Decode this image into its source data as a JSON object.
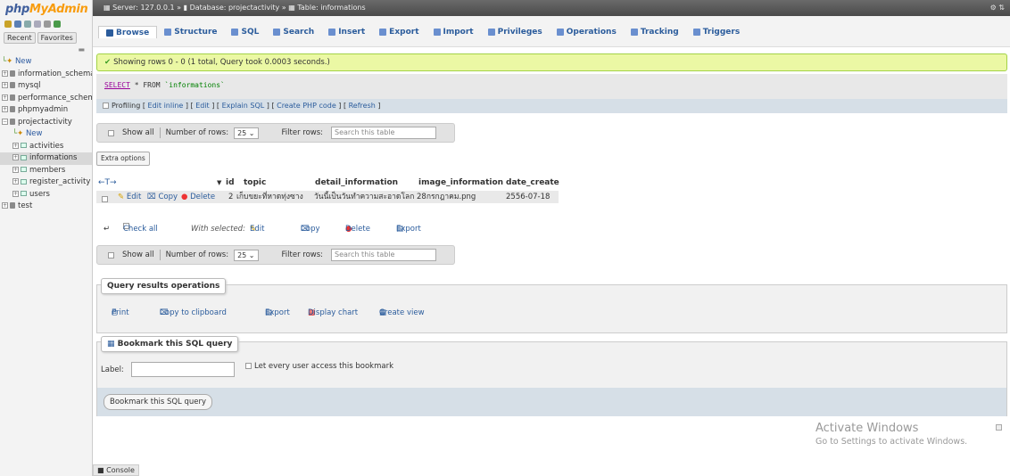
{
  "nav": {
    "logo": {
      "php": "php",
      "my": "My",
      "admin": "Admin"
    },
    "tabs": [
      "Recent",
      "Favorites"
    ],
    "items": [
      {
        "label": "New",
        "kind": "new",
        "level": 0
      },
      {
        "label": "information_schema",
        "kind": "db",
        "level": 0
      },
      {
        "label": "mysql",
        "kind": "db",
        "level": 0
      },
      {
        "label": "performance_schema",
        "kind": "db",
        "level": 0
      },
      {
        "label": "phpmyadmin",
        "kind": "db",
        "level": 0
      },
      {
        "label": "projectactivity",
        "kind": "db",
        "level": 0
      },
      {
        "label": "New",
        "kind": "new",
        "level": 1
      },
      {
        "label": "activities",
        "kind": "table",
        "level": 1
      },
      {
        "label": "informations",
        "kind": "table",
        "level": 1,
        "selected": true
      },
      {
        "label": "members",
        "kind": "table",
        "level": 1
      },
      {
        "label": "register_activity",
        "kind": "table",
        "level": 1
      },
      {
        "label": "users",
        "kind": "table",
        "level": 1
      },
      {
        "label": "test",
        "kind": "db",
        "level": 0
      }
    ]
  },
  "breadcrumb": {
    "server": "Server: 127.0.0.1",
    "database": "Database: projectactivity",
    "table": "Table: informations",
    "sep": "»"
  },
  "tabs": [
    {
      "label": "Browse",
      "icon": "browse-icon",
      "color": "#2b5c9c",
      "active": true
    },
    {
      "label": "Structure",
      "icon": "structure-icon",
      "color": "#6a8fcf"
    },
    {
      "label": "SQL",
      "icon": "sql-icon",
      "color": "#6a8fcf"
    },
    {
      "label": "Search",
      "icon": "search-icon",
      "color": "#6a8fcf"
    },
    {
      "label": "Insert",
      "icon": "insert-icon",
      "color": "#6a8fcf"
    },
    {
      "label": "Export",
      "icon": "export-icon",
      "color": "#6a8fcf"
    },
    {
      "label": "Import",
      "icon": "import-icon",
      "color": "#6a8fcf"
    },
    {
      "label": "Privileges",
      "icon": "privileges-icon",
      "color": "#6a8fcf"
    },
    {
      "label": "Operations",
      "icon": "wrench-icon",
      "color": "#6a8fcf"
    },
    {
      "label": "Tracking",
      "icon": "tracking-icon",
      "color": "#6a8fcf"
    },
    {
      "label": "Triggers",
      "icon": "triggers-icon",
      "color": "#6a8fcf"
    }
  ],
  "message": {
    "text": "Showing rows 0 - 0 (1 total, Query took 0.0003 seconds.)"
  },
  "sql": {
    "select": "SELECT",
    "rest": " * FROM ",
    "table": "`informations`"
  },
  "profiling": {
    "label": "Profiling",
    "links": [
      "Edit inline",
      "Edit",
      "Explain SQL",
      "Create PHP code",
      "Refresh"
    ]
  },
  "navigation": {
    "show_all": "Show all",
    "rows_label": "Number of rows:",
    "rows_value": "25",
    "filter_label": "Filter rows:",
    "filter_placeholder": "Search this table"
  },
  "extra_options": "Extra options",
  "table": {
    "columns": [
      "id",
      "topic",
      "detail_information",
      "image_information",
      "date_create"
    ],
    "row": {
      "edit": "Edit",
      "copy": "Copy",
      "delete": "Delete",
      "id": "2",
      "topic": "เก็บขยะที่หาดทุ่งซาง",
      "detail_information": "วันนี้เป็นวันทำความสะอาดโลก",
      "image_information": "28กรกฎาคม.png",
      "date_create": "2556-07-18"
    }
  },
  "with_selected": {
    "check_all": "Check all",
    "label": "With selected:",
    "edit": "Edit",
    "copy": "Copy",
    "delete": "Delete",
    "export": "Export"
  },
  "query_ops": {
    "legend": "Query results operations",
    "print": "Print",
    "copy": "Copy to clipboard",
    "export": "Export",
    "chart": "Display chart",
    "view": "Create view"
  },
  "bookmark": {
    "legend": "Bookmark this SQL query",
    "label": "Label:",
    "check": "Let every user access this bookmark",
    "button": "Bookmark this SQL query"
  },
  "watermark": {
    "title": "Activate Windows",
    "subtitle": "Go to Settings to activate Windows."
  },
  "console": "Console"
}
